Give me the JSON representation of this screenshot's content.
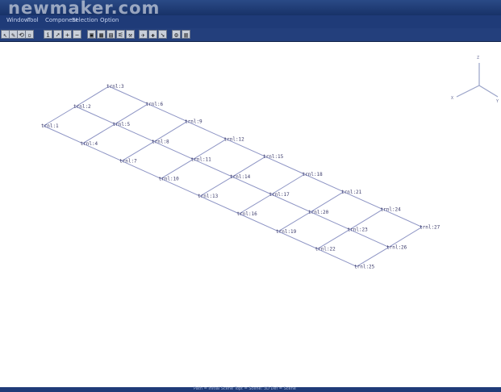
{
  "app": {
    "logo_text": "newmaker.com"
  },
  "menu": {
    "items": [
      {
        "id": "window",
        "label": "Window"
      },
      {
        "id": "tool",
        "label": "Tool"
      },
      {
        "id": "component",
        "label": "Component"
      },
      {
        "id": "selection",
        "label": "Selection"
      },
      {
        "id": "option",
        "label": "Option"
      }
    ]
  },
  "toolbar": {
    "buttons": [
      {
        "id": "select",
        "icon": "arrow-select-icon",
        "glyph": "↖"
      },
      {
        "id": "pencil",
        "icon": "pencil-icon",
        "glyph": "✎"
      },
      {
        "id": "rotate",
        "icon": "rotate-icon",
        "glyph": "⟲"
      },
      {
        "id": "box",
        "icon": "box-icon",
        "glyph": "▫"
      },
      {
        "id": "info",
        "icon": "info-icon",
        "glyph": "i"
      },
      {
        "id": "pointer",
        "icon": "pointer-icon",
        "glyph": "➚"
      },
      {
        "id": "add",
        "icon": "plus-icon",
        "glyph": "+"
      },
      {
        "id": "remove",
        "icon": "minus-icon",
        "glyph": "−"
      },
      {
        "id": "view1",
        "icon": "window-icon",
        "glyph": "▣"
      },
      {
        "id": "view2",
        "icon": "grid-icon",
        "glyph": "▦"
      },
      {
        "id": "view3",
        "icon": "table-icon",
        "glyph": "▤"
      },
      {
        "id": "view4",
        "icon": "measure-icon",
        "glyph": "⚟"
      },
      {
        "id": "view5",
        "icon": "tools-icon",
        "glyph": "⚒"
      },
      {
        "id": "tool1",
        "icon": "wrench-icon",
        "glyph": "✈"
      },
      {
        "id": "tool2",
        "icon": "cross-icon",
        "glyph": "✚"
      },
      {
        "id": "tool3",
        "icon": "arrow-icon",
        "glyph": "➘"
      },
      {
        "id": "tool4",
        "icon": "settings-icon",
        "glyph": "⚙"
      },
      {
        "id": "tool5",
        "icon": "chart-icon",
        "glyph": "▥"
      }
    ]
  },
  "axes": {
    "z_label": "Z",
    "x_label": "X",
    "y_label": "Y"
  },
  "nodes": [
    {
      "id": "trnl:3"
    },
    {
      "id": "trnl:2"
    },
    {
      "id": "trnl:1"
    },
    {
      "id": "trnl:6"
    },
    {
      "id": "trnl:5"
    },
    {
      "id": "trnl:4"
    },
    {
      "id": "trnl:9"
    },
    {
      "id": "trnl:8"
    },
    {
      "id": "trnl:7"
    },
    {
      "id": "trnl:12"
    },
    {
      "id": "trnl:11"
    },
    {
      "id": "trnl:10"
    },
    {
      "id": "trnl:15"
    },
    {
      "id": "trnl:14"
    },
    {
      "id": "trnl:13"
    },
    {
      "id": "trnl:18"
    },
    {
      "id": "trnl:17"
    },
    {
      "id": "trnl:16"
    },
    {
      "id": "trnl:21"
    },
    {
      "id": "trnl:20"
    },
    {
      "id": "trnl:19"
    },
    {
      "id": "trnl:24"
    },
    {
      "id": "trnl:23"
    },
    {
      "id": "trnl:22"
    },
    {
      "id": "trnl:27"
    },
    {
      "id": "trnl:26"
    },
    {
      "id": "trnl:25"
    }
  ],
  "statusbar": {
    "text": "Path = Initial Scene   Topt = Scene: 3D   Def = Scene"
  }
}
